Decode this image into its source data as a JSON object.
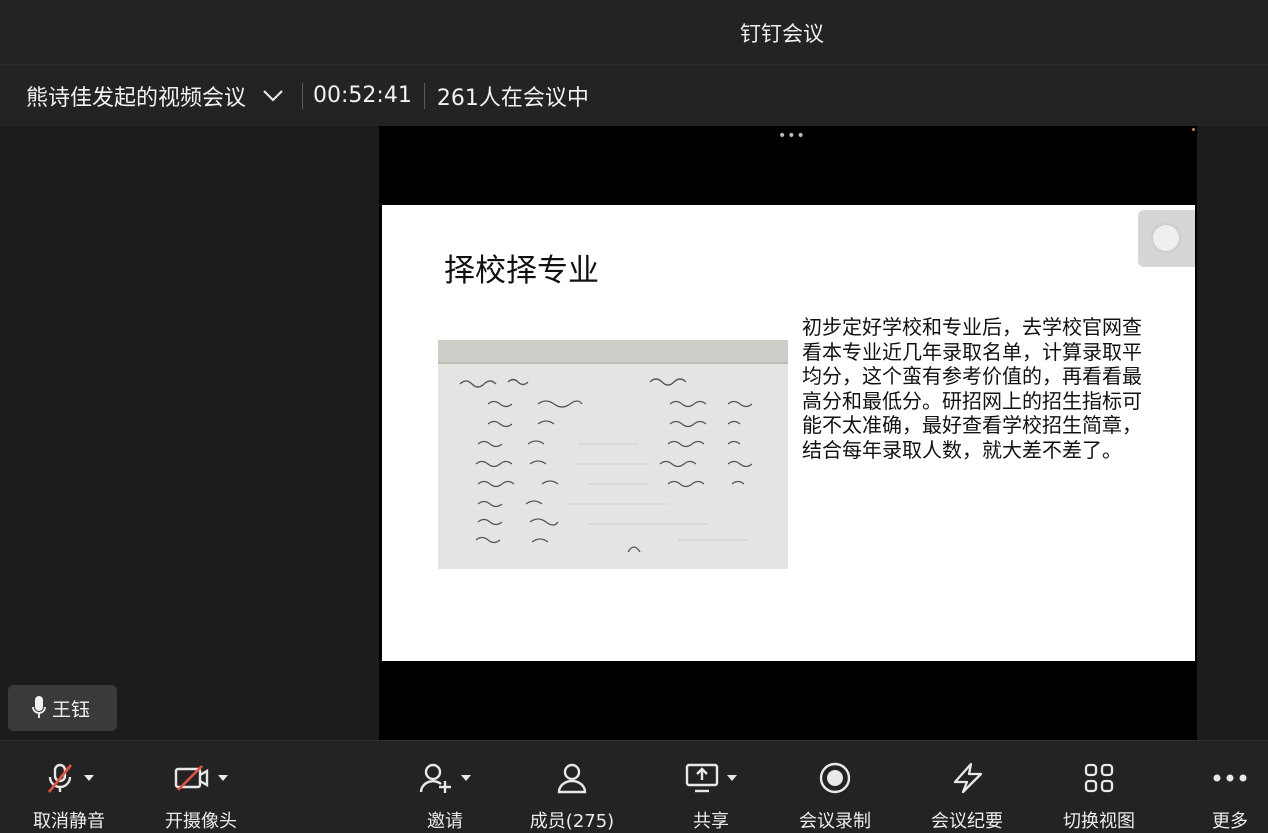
{
  "app": {
    "title": "钉钉会议"
  },
  "meeting": {
    "title": "熊诗佳发起的视频会议",
    "timer": "00:52:41",
    "participants": "261人在会议中"
  },
  "slide": {
    "title": "择校择专业",
    "body": "初步定好学校和专业后，去学校官网查看本专业近几年录取名单，计算录取平均分，这个蛮有参考价值的，再看看最高分和最低分。研招网上的招生指标可能不太准确，最好查看学校招生简章，结合每年录取人数，就大差不差了。"
  },
  "speaker": {
    "name": "王钰"
  },
  "toolbar": {
    "unmute": "取消静音",
    "camera": "开摄像头",
    "invite": "邀请",
    "members": "成员(275)",
    "share": "共享",
    "record": "会议录制",
    "minutes": "会议纪要",
    "switch_view": "切换视图",
    "more": "更多"
  },
  "colors": {
    "muted_red": "#e5533d",
    "background": "#1c1c1e",
    "bar": "#232325"
  }
}
